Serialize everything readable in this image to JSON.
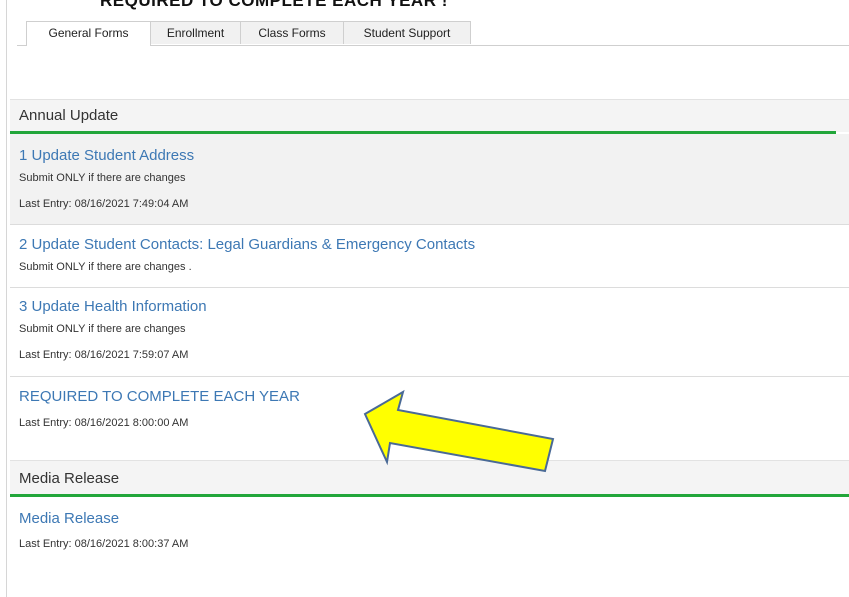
{
  "banner": "REQUIRED TO COMPLETE EACH YEAR !",
  "tabs": [
    {
      "label": "General Forms",
      "active": true
    },
    {
      "label": "Enrollment",
      "active": false
    },
    {
      "label": "Class Forms",
      "active": false
    },
    {
      "label": "Student Support",
      "active": false
    }
  ],
  "sections": {
    "annual_update": {
      "title": "Annual Update",
      "items": [
        {
          "link": "1 Update Student Address",
          "note": "Submit ONLY if there are changes",
          "last_entry": "Last Entry: 08/16/2021 7:49:04 AM"
        },
        {
          "link": "2 Update Student Contacts: Legal Guardians & Emergency Contacts",
          "note": "Submit ONLY if there are changes ."
        },
        {
          "link": "3 Update Health Information",
          "note": "Submit ONLY if there are changes",
          "last_entry": "Last Entry: 08/16/2021 7:59:07 AM"
        },
        {
          "link": "REQUIRED TO COMPLETE EACH YEAR",
          "last_entry": "Last Entry: 08/16/2021 8:00:00 AM"
        }
      ]
    },
    "media_release": {
      "title": "Media Release",
      "items": [
        {
          "link": "Media Release",
          "last_entry": "Last Entry: 08/16/2021 8:00:37 AM"
        }
      ]
    }
  },
  "colors": {
    "link": "#3d78b4",
    "accent_bar": "#22a63a",
    "arrow_fill": "#ffff00",
    "arrow_stroke": "#4a6a96"
  },
  "annotation": {
    "type": "arrow",
    "icon": "arrow-annotation-icon",
    "points_to": "REQUIRED TO COMPLETE EACH YEAR"
  }
}
